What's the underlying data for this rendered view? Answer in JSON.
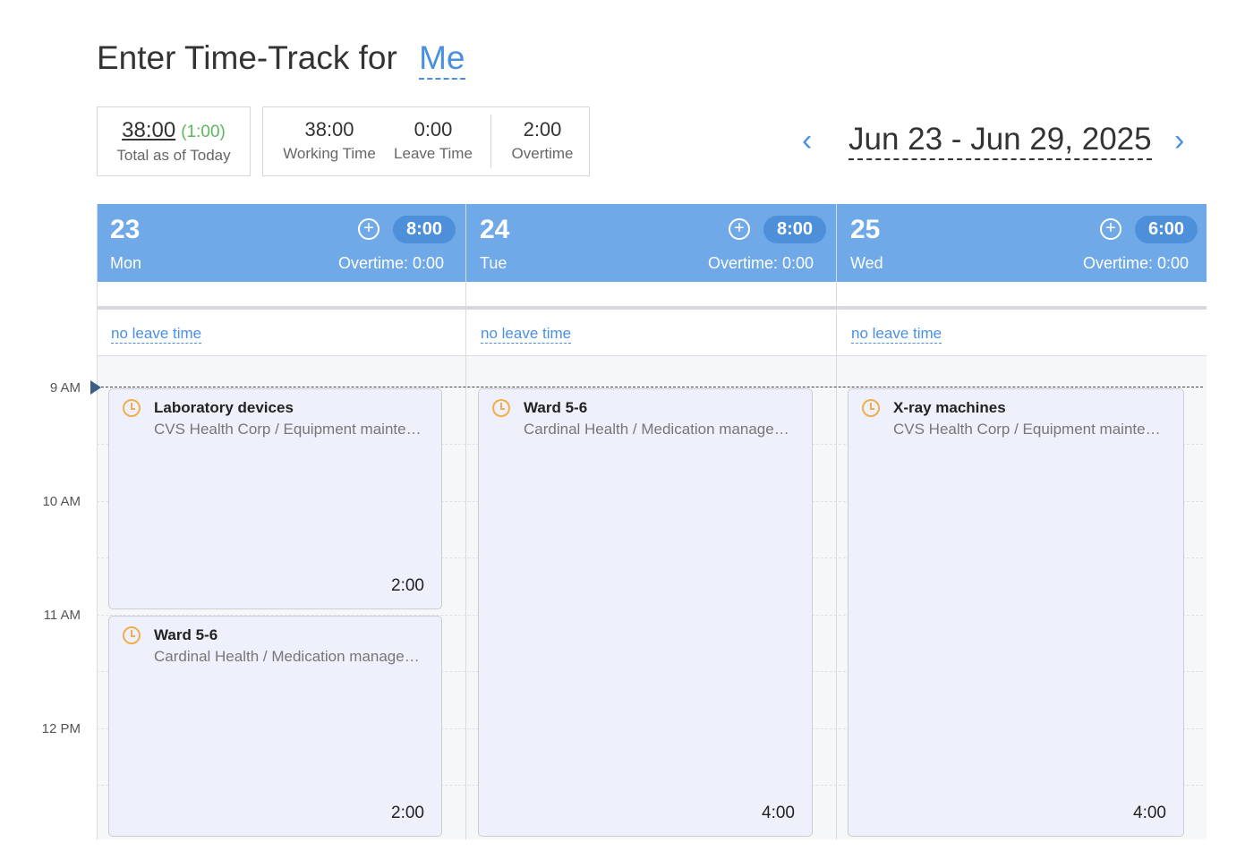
{
  "header": {
    "title_prefix": "Enter Time-Track for",
    "title_user": "Me"
  },
  "summary": {
    "total": "38:00",
    "total_diff": "(1:00)",
    "total_label": "Total as of Today",
    "working_time": "38:00",
    "working_time_label": "Working Time",
    "leave_time": "0:00",
    "leave_time_label": "Leave Time",
    "overtime": "2:00",
    "overtime_label": "Overtime"
  },
  "date_nav": {
    "range": "Jun 23 - Jun 29, 2025",
    "prev_icon": "chevron-left-icon",
    "next_icon": "chevron-right-icon"
  },
  "hours": [
    "9 AM",
    "10 AM",
    "11 AM",
    "12 PM"
  ],
  "days": [
    {
      "num": "23",
      "name": "Mon",
      "hours": "8:00",
      "overtime": "Overtime:  0:00",
      "leave": "no leave time",
      "entries": [
        {
          "title": "Laboratory devices",
          "sub": "CVS Health Corp / Equipment maintenance",
          "duration": "2:00"
        },
        {
          "title": "Ward 5-6",
          "sub": "Cardinal Health / Medication management",
          "duration": "2:00"
        }
      ]
    },
    {
      "num": "24",
      "name": "Tue",
      "hours": "8:00",
      "overtime": "Overtime:  0:00",
      "leave": "no leave time",
      "entries": [
        {
          "title": "Ward 5-6",
          "sub": "Cardinal Health / Medication management",
          "duration": "4:00"
        }
      ]
    },
    {
      "num": "25",
      "name": "Wed",
      "hours": "6:00",
      "overtime": "Overtime:  0:00",
      "leave": "no leave time",
      "entries": [
        {
          "title": "X-ray machines",
          "sub": "CVS Health Corp / Equipment maintenance",
          "duration": "4:00"
        }
      ]
    }
  ],
  "colors": {
    "accent": "#4a90e2",
    "day_header": "#6fa9e8",
    "badge": "#4d8fd8",
    "clock": "#f0ad4e",
    "positive": "#5cb85c"
  }
}
